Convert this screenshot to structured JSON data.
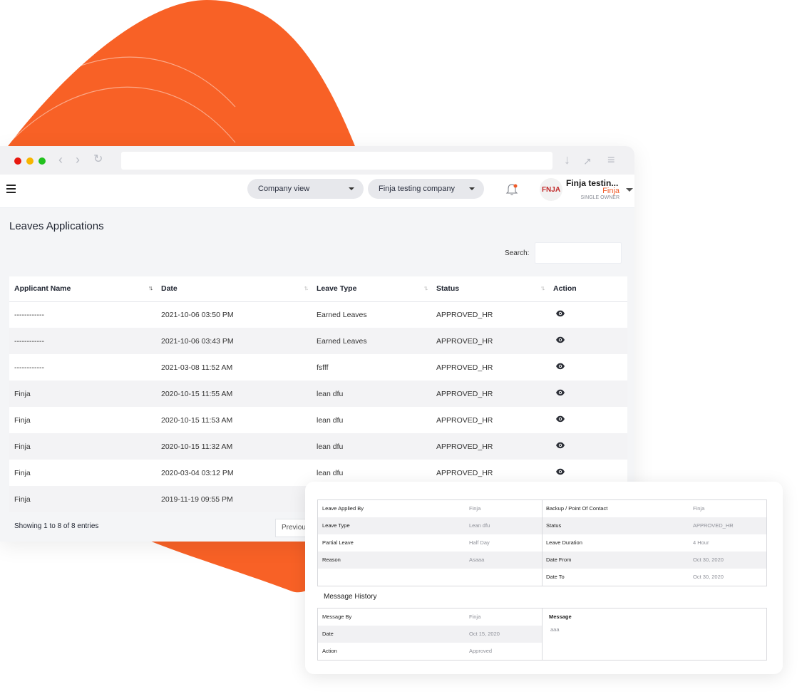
{
  "colors": {
    "accent": "#f86126",
    "status_dot_red": "#e8180f",
    "status_dot_yellow": "#f7b500",
    "status_dot_green": "#22c11e"
  },
  "browser": {
    "icons": [
      "back-icon",
      "forward-icon",
      "refresh-icon",
      "download-icon",
      "expand-icon",
      "menu-icon"
    ]
  },
  "header": {
    "company_view": "Company view",
    "company_name": "Finja testing company",
    "user_name": "Finja testin...",
    "user_company": "Finja",
    "user_role": "SINGLE OWNER",
    "avatar_text": "FNJA"
  },
  "page": {
    "title": "Leaves Applications",
    "search_label": "Search:"
  },
  "table": {
    "columns": [
      "Applicant Name",
      "Date",
      "Leave Type",
      "Status",
      "Action"
    ],
    "rows": [
      [
        "------------",
        "2021-10-06 03:50 PM",
        "Earned Leaves",
        "APPROVED_HR"
      ],
      [
        "------------",
        "2021-10-06 03:43 PM",
        "Earned Leaves",
        "APPROVED_HR"
      ],
      [
        "------------",
        "2021-03-08 11:52 AM",
        "fsfff",
        "APPROVED_HR"
      ],
      [
        "Finja",
        "2020-10-15 11:55 AM",
        "lean dfu",
        "APPROVED_HR"
      ],
      [
        "Finja",
        "2020-10-15 11:53 AM",
        "lean dfu",
        "APPROVED_HR"
      ],
      [
        "Finja",
        "2020-10-15 11:32 AM",
        "lean dfu",
        "APPROVED_HR"
      ],
      [
        "Finja",
        "2020-03-04 03:12 PM",
        "lean dfu",
        "APPROVED_HR"
      ],
      [
        "Finja",
        "2019-11-19 09:55 PM",
        "",
        ""
      ]
    ],
    "showing": "Showing 1 to 8 of 8 entries",
    "previous": "Previous"
  },
  "detail": {
    "left": [
      {
        "label": "Leave Applied By",
        "value": "Finja"
      },
      {
        "label": "Leave Type",
        "value": "Lean dfu"
      },
      {
        "label": "Partial Leave",
        "value": "Half Day"
      },
      {
        "label": "Reason",
        "value": "Asaaa"
      }
    ],
    "right": [
      {
        "label": "Backup / Point Of Contact",
        "value": "Finja"
      },
      {
        "label": "Status",
        "value": "APPROVED_HR"
      },
      {
        "label": "Leave Duration",
        "value": "4 Hour"
      },
      {
        "label": "Date From",
        "value": "Oct 30, 2020"
      },
      {
        "label": "Date To",
        "value": "Oct 30, 2020"
      }
    ],
    "message_history_title": "Message History",
    "message_fields": [
      {
        "label": "Message By",
        "value": "Finja"
      },
      {
        "label": "Date",
        "value": "Oct 15, 2020"
      },
      {
        "label": "Action",
        "value": "Approved"
      }
    ],
    "message_label": "Message",
    "message_text": "aaa"
  }
}
